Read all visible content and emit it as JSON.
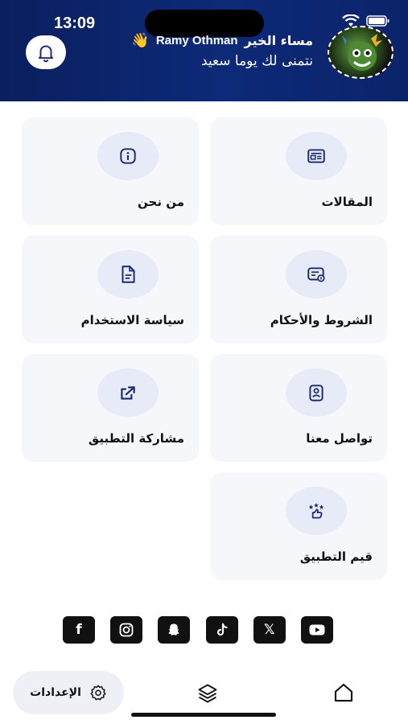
{
  "status_bar": {
    "time": "13:09"
  },
  "header": {
    "greeting": "مساء الخير",
    "user_name": "Ramy Othman",
    "wave_emoji": "👋",
    "subtitle": "نتمنى لك يوما سعيد"
  },
  "cards": [
    {
      "label": "المقالات",
      "icon": "newspaper-icon"
    },
    {
      "label": "من نحن",
      "icon": "info-icon"
    },
    {
      "label": "الشروط والأحكام",
      "icon": "terms-icon"
    },
    {
      "label": "سياسة الاستخدام",
      "icon": "document-icon"
    },
    {
      "label": "تواصل معنا",
      "icon": "contact-icon"
    },
    {
      "label": "مشاركة التطبيق",
      "icon": "share-icon"
    },
    {
      "label": "قيم التطبيق",
      "icon": "rate-icon"
    }
  ],
  "socials": [
    {
      "name": "facebook-icon",
      "glyph": "f"
    },
    {
      "name": "instagram-icon"
    },
    {
      "name": "snapchat-icon"
    },
    {
      "name": "tiktok-icon"
    },
    {
      "name": "x-icon",
      "glyph": "𝕏"
    },
    {
      "name": "youtube-icon"
    }
  ],
  "bottom_nav": {
    "settings_label": "الإعدادات"
  },
  "colors": {
    "header": "#0d2a78",
    "card_bg": "#f6f7fb",
    "icon_circle": "#e7ebf7",
    "icon_color": "#1b2b6b"
  }
}
